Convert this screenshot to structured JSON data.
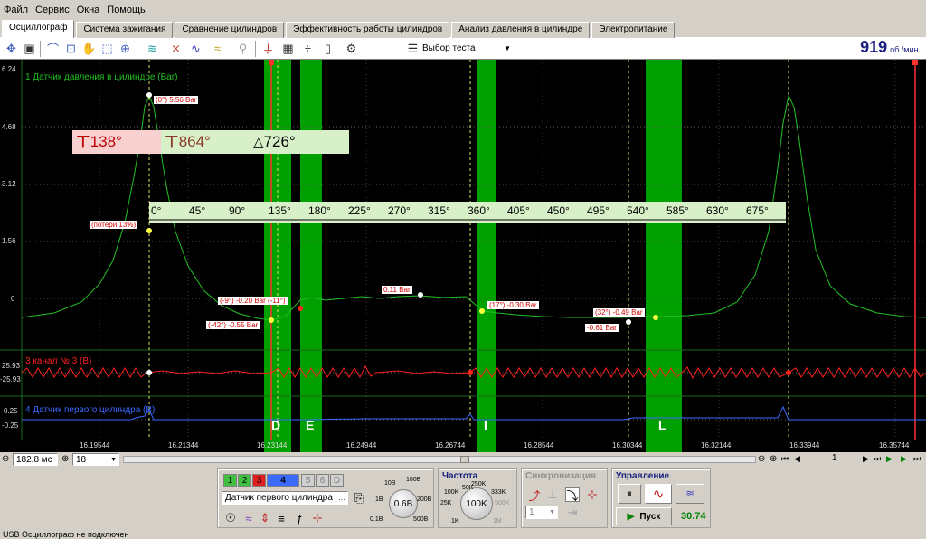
{
  "menu": [
    "Файл",
    "Сервис",
    "Окна",
    "Помощь"
  ],
  "tabs": [
    {
      "label": "Осциллограф",
      "active": true
    },
    {
      "label": "Система зажигания"
    },
    {
      "label": "Сравнение цилиндров"
    },
    {
      "label": "Эффективность работы цилиндров"
    },
    {
      "label": "Анализ давления в цилиндре"
    },
    {
      "label": "Электропитание"
    }
  ],
  "toolbar": {
    "test_select_label": "Выбор теста"
  },
  "rpm": {
    "value": "919",
    "unit": "об./мин."
  },
  "scope": {
    "channel1_label": "1 Датчик давления в цилиндре (Bar)",
    "channel3_label": "3 канал № 3 (В)",
    "channel4_label": "4 Датчик первого цилиндра (В)",
    "y_ticks": [
      "6.24",
      "4.68",
      "3.12",
      "1.56",
      "0",
      "25.93",
      "-25.93",
      "0.25",
      "-0.25"
    ],
    "x_ticks": [
      "16.19544",
      "16.21344",
      "16.23144",
      "16.24944",
      "16.26744",
      "16.28544",
      "16.30344",
      "16.32144",
      "16.33944",
      "16.35744"
    ],
    "angle_ticks": [
      "0°",
      "45°",
      "90°",
      "135°",
      "180°",
      "225°",
      "270°",
      "315°",
      "360°",
      "405°",
      "450°",
      "495°",
      "540°",
      "585°",
      "630°",
      "675°"
    ],
    "cursor_left": "138°",
    "cursor_right": "864°",
    "cursor_delta": "726°",
    "annotations": {
      "peak": "(0°) 5.56 Bar",
      "loss": "(потери 13%)",
      "a1": "(-9°) -0.20 Bar (-11°)",
      "a2": "(-42°) -0.55 Bar",
      "a3": "0.11 Bar",
      "a4": "(17°) -0.30 Bar",
      "a5": "(32°) -0.49 Bar",
      "a6": "-0.61 Bar"
    },
    "phase_labels": [
      "D",
      "E",
      "I",
      "L"
    ]
  },
  "bottombar": {
    "timebase": "182.8 мс",
    "count": "18",
    "page": "1"
  },
  "channels_panel": {
    "channel_buttons": [
      "1",
      "2",
      "3",
      "4",
      "5",
      "6",
      "D"
    ],
    "sensor_select": "Датчик первого цилиндра",
    "dial_value": "0.6В",
    "dial_labels": [
      "10В",
      "100В",
      "200В",
      "500В",
      "0.1В",
      "1В"
    ]
  },
  "frequency": {
    "title": "Частота",
    "dial_value": "100K",
    "dial_labels": [
      "100K",
      "250K",
      "333K",
      "50K",
      "25K",
      "1K",
      "500K",
      "1M"
    ]
  },
  "sync": {
    "title": "Синхронизация",
    "channel_select": "1"
  },
  "control": {
    "title": "Управление",
    "start_label": "Пуск",
    "value": "30.74"
  },
  "status": {
    "text": "USB Осциллограф не подключен"
  },
  "colors": {
    "ch1": "#22c022",
    "ch3": "#ff2020",
    "ch4": "#3a6aff",
    "green_band": "#00a000",
    "label_bg": "#e8ffd8"
  }
}
